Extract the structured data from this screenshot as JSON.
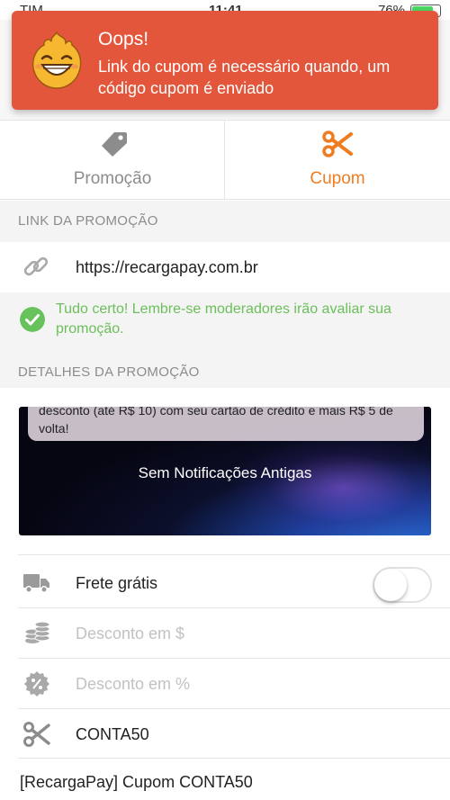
{
  "status_bar": {
    "carrier": "TIM",
    "time": "11:41",
    "battery": "76%",
    "battery_level": 0.76
  },
  "toast": {
    "title": "Oops!",
    "message": "Link do cupom é necessário quando, um código cupom é enviado",
    "icon": "smiling-flame-face-icon",
    "color": "#e4563b"
  },
  "type_selector": {
    "options": [
      {
        "label": "Promoção",
        "icon": "tag-icon",
        "selected": false
      },
      {
        "label": "Cupom",
        "icon": "scissors-icon",
        "selected": true
      }
    ],
    "accent": "#ee7d21"
  },
  "link_section": {
    "header": "LINK DA PROMOÇÃO",
    "url": "https://recargapay.com.br",
    "icon": "link-icon",
    "success_message": "Tudo certo! Lembre-se moderadores irão avaliar sua promoção.",
    "success_color": "#67c25c"
  },
  "details_section": {
    "header": "DETALHES DA PROMOÇÃO",
    "preview_notification_text": "desconto (até R$ 10) com seu cartão de crédito e mais R$ 5 de volta!",
    "preview_center_text": "Sem Notificações Antigas"
  },
  "fields": {
    "free_shipping": {
      "label": "Frete grátis",
      "icon": "truck-icon",
      "enabled": false
    },
    "discount_amount": {
      "placeholder": "Desconto em $",
      "icon": "coins-icon"
    },
    "discount_percent": {
      "placeholder": "Desconto em %",
      "icon": "percent-badge-icon"
    },
    "coupon_code": {
      "value": "CONTA50",
      "icon": "scissors-icon"
    },
    "title": {
      "value": "[RecargaPay] Cupom CONTA50"
    }
  }
}
